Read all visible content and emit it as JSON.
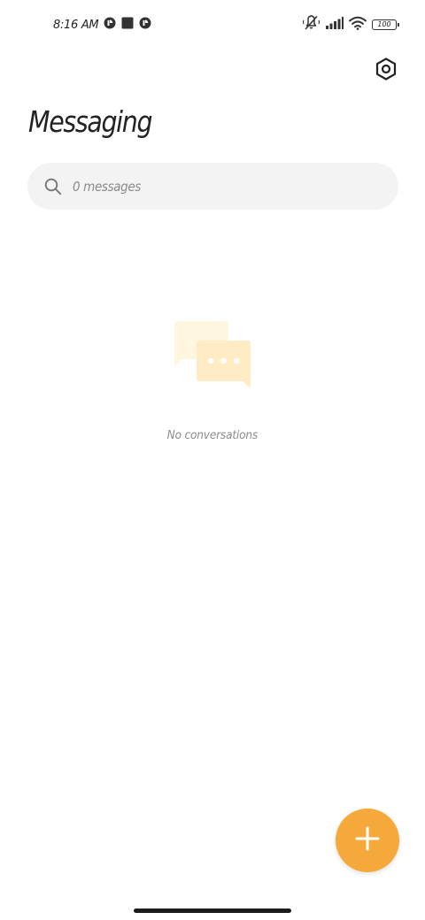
{
  "status_bar": {
    "time": "8:16 AM",
    "battery": "100",
    "icons": [
      "media-icon",
      "app-icon",
      "media-icon",
      "mute-icon",
      "signal-icon",
      "wifi-icon",
      "battery-icon"
    ]
  },
  "header": {
    "title": "Messaging",
    "settings_icon": "settings-icon"
  },
  "search": {
    "placeholder": "0 messages",
    "icon": "search-icon"
  },
  "empty_state": {
    "icon": "chat-bubbles-icon",
    "text": "No conversations"
  },
  "fab": {
    "icon": "plus-icon",
    "color": "#F5A93A"
  },
  "colors": {
    "accent": "#F5A93A",
    "illustration_light": "#FFF6E0",
    "illustration_mid": "#FFECC4",
    "search_background": "#F3F3F3"
  }
}
